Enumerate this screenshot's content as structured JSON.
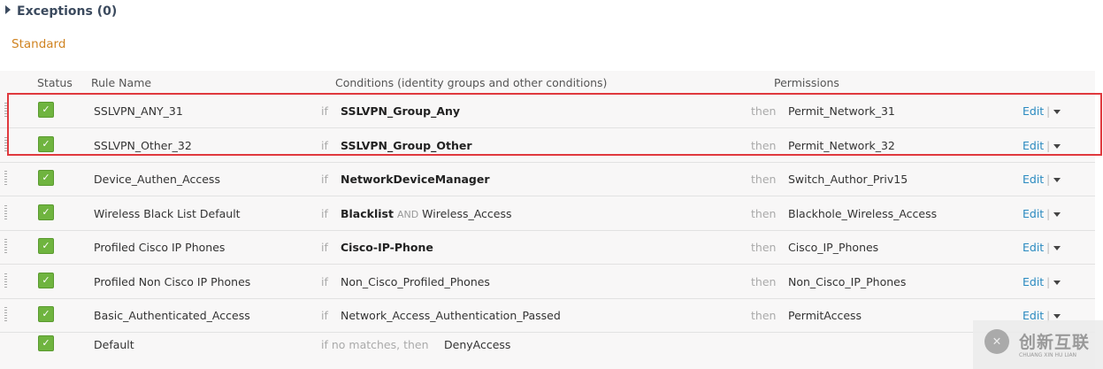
{
  "exceptions_label": "Exceptions (0)",
  "section": "Standard",
  "headers": {
    "status": "Status",
    "rule": "Rule Name",
    "conditions": "Conditions (identity groups and other conditions)",
    "permissions": "Permissions"
  },
  "rows": [
    {
      "name": "SSLVPN_ANY_31",
      "if": "if",
      "cond_bold": "SSLVPN_Group_Any",
      "cond_and": "",
      "cond_rest": "",
      "then": "then",
      "perm": "Permit_Network_31",
      "edit": "Edit"
    },
    {
      "name": "SSLVPN_Other_32",
      "if": "if",
      "cond_bold": "SSLVPN_Group_Other",
      "cond_and": "",
      "cond_rest": "",
      "then": "then",
      "perm": "Permit_Network_32",
      "edit": "Edit"
    },
    {
      "name": "Device_Authen_Access",
      "if": "if",
      "cond_bold": "NetworkDeviceManager",
      "cond_and": "",
      "cond_rest": "",
      "then": "then",
      "perm": "Switch_Author_Priv15",
      "edit": "Edit"
    },
    {
      "name": "Wireless Black List Default",
      "if": "if",
      "cond_bold": "Blacklist",
      "cond_and": "AND",
      "cond_rest": "Wireless_Access",
      "then": "then",
      "perm": "Blackhole_Wireless_Access",
      "edit": "Edit"
    },
    {
      "name": "Profiled Cisco IP Phones",
      "if": "if",
      "cond_bold": "Cisco-IP-Phone",
      "cond_and": "",
      "cond_rest": "",
      "then": "then",
      "perm": "Cisco_IP_Phones",
      "edit": "Edit"
    },
    {
      "name": "Profiled Non Cisco IP Phones",
      "if": "if",
      "cond_bold": "",
      "cond_and": "",
      "cond_rest": "Non_Cisco_Profiled_Phones",
      "then": "then",
      "perm": "Non_Cisco_IP_Phones",
      "edit": "Edit"
    },
    {
      "name": "Basic_Authenticated_Access",
      "if": "if",
      "cond_bold": "",
      "cond_and": "",
      "cond_rest": "Network_Access_Authentication_Passed",
      "then": "then",
      "perm": "PermitAccess",
      "edit": "Edit"
    }
  ],
  "default_row": {
    "name": "Default",
    "if": "if no matches, then",
    "perm": "DenyAccess"
  },
  "edit_separator": "|",
  "watermark": {
    "cn": "创新互联",
    "en": "CHUANG XIN HU LIAN"
  },
  "colors": {
    "accent": "#2a8ac0",
    "highlight": "#e0393e",
    "check": "#6fb43f",
    "section": "#d08320"
  }
}
